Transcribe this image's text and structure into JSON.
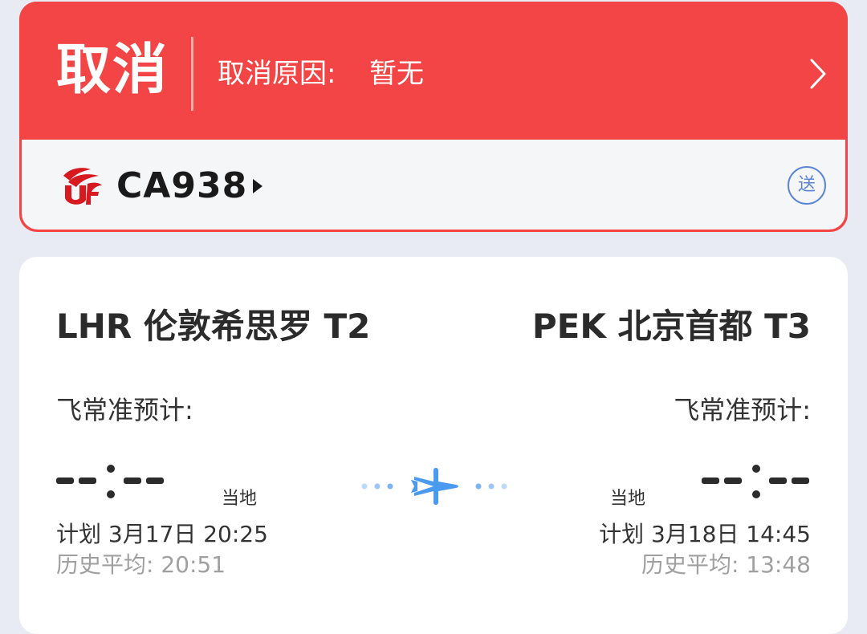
{
  "status": {
    "title": "取消",
    "reason_label": "取消原因:",
    "reason_value": "暂无",
    "accent_color": "#f44546"
  },
  "flight": {
    "number": "CA938",
    "airline_icon": "air-china-logo",
    "send_badge": "送"
  },
  "route": {
    "departure": {
      "airport": "LHR 伦敦希思罗 T2",
      "estimate_label": "飞常准预计:",
      "estimate_time": "--:--",
      "local_tag": "当地",
      "planned": "计划 3月17日 20:25",
      "history": "历史平均: 20:51"
    },
    "arrival": {
      "airport": "PEK 北京首都 T3",
      "estimate_label": "飞常准预计:",
      "estimate_time": "--:--",
      "local_tag": "当地",
      "planned": "计划 3月18日 14:45",
      "history": "历史平均: 13:48"
    },
    "plane_icon": "airplane-icon",
    "plane_color": "#4a9af0"
  }
}
